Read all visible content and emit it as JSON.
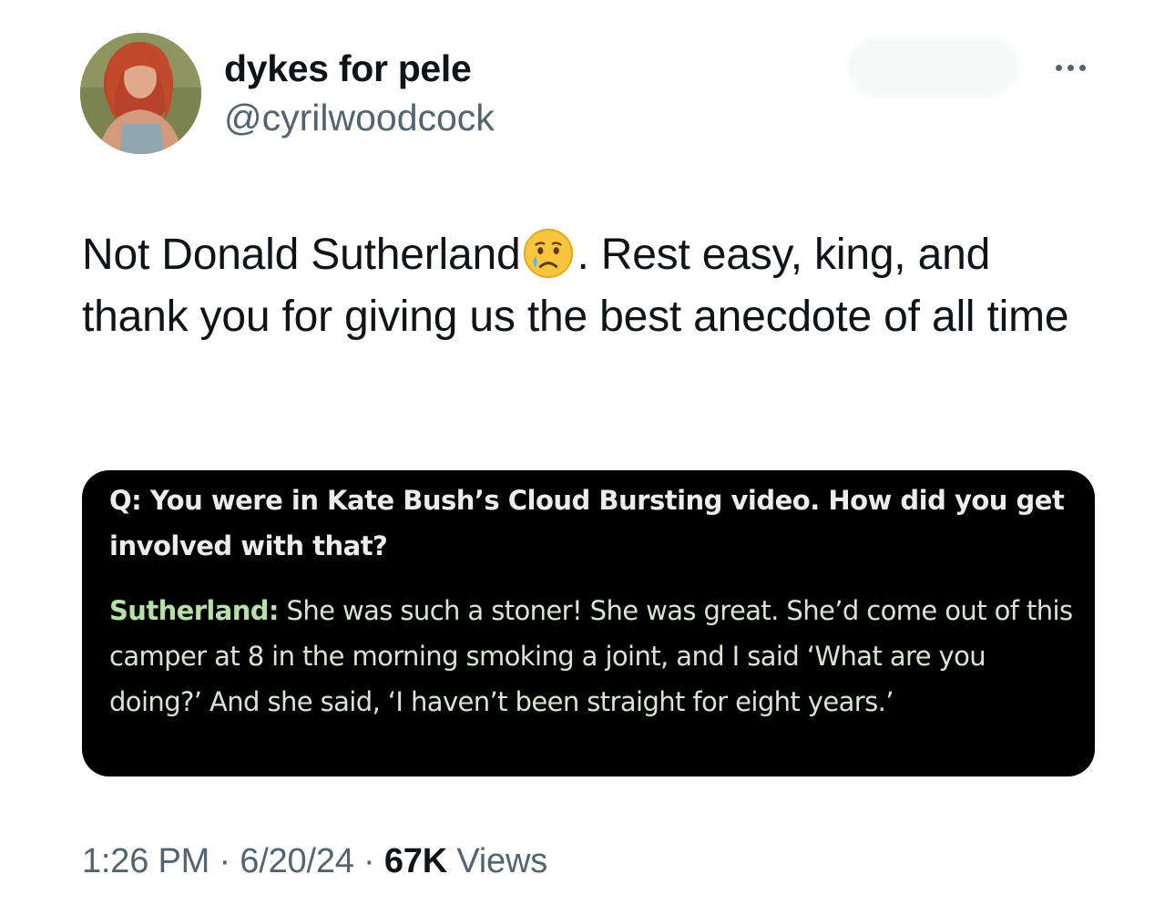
{
  "author": {
    "display_name": "dykes for pele",
    "handle": "@cyrilwoodcock",
    "avatar_icon": "profile-photo"
  },
  "tweet": {
    "text_before_emoji": "Not Donald Sutherland",
    "emoji": "crying-face-emoji",
    "text_after_emoji": ". Rest easy, king, and thank you for giving us the best anecdote of all time"
  },
  "quote_image": {
    "question": "Q: You were in Kate Bush’s Cloud Bursting video. How did you get involved with that?",
    "speaker": "Sutherland:",
    "answer": " She was such a stoner! She was great. She’d come out of this camper at 8 in the morning smoking a joint, and I said ‘What are you doing?’ And she said, ‘I haven’t been straight for eight years.’"
  },
  "meta": {
    "time": "1:26 PM",
    "separator": " · ",
    "date": "6/20/24",
    "views_count": "67K",
    "views_label": " Views"
  },
  "colors": {
    "text_primary": "#0f1419",
    "text_secondary": "#536471",
    "media_bg": "#000000"
  }
}
